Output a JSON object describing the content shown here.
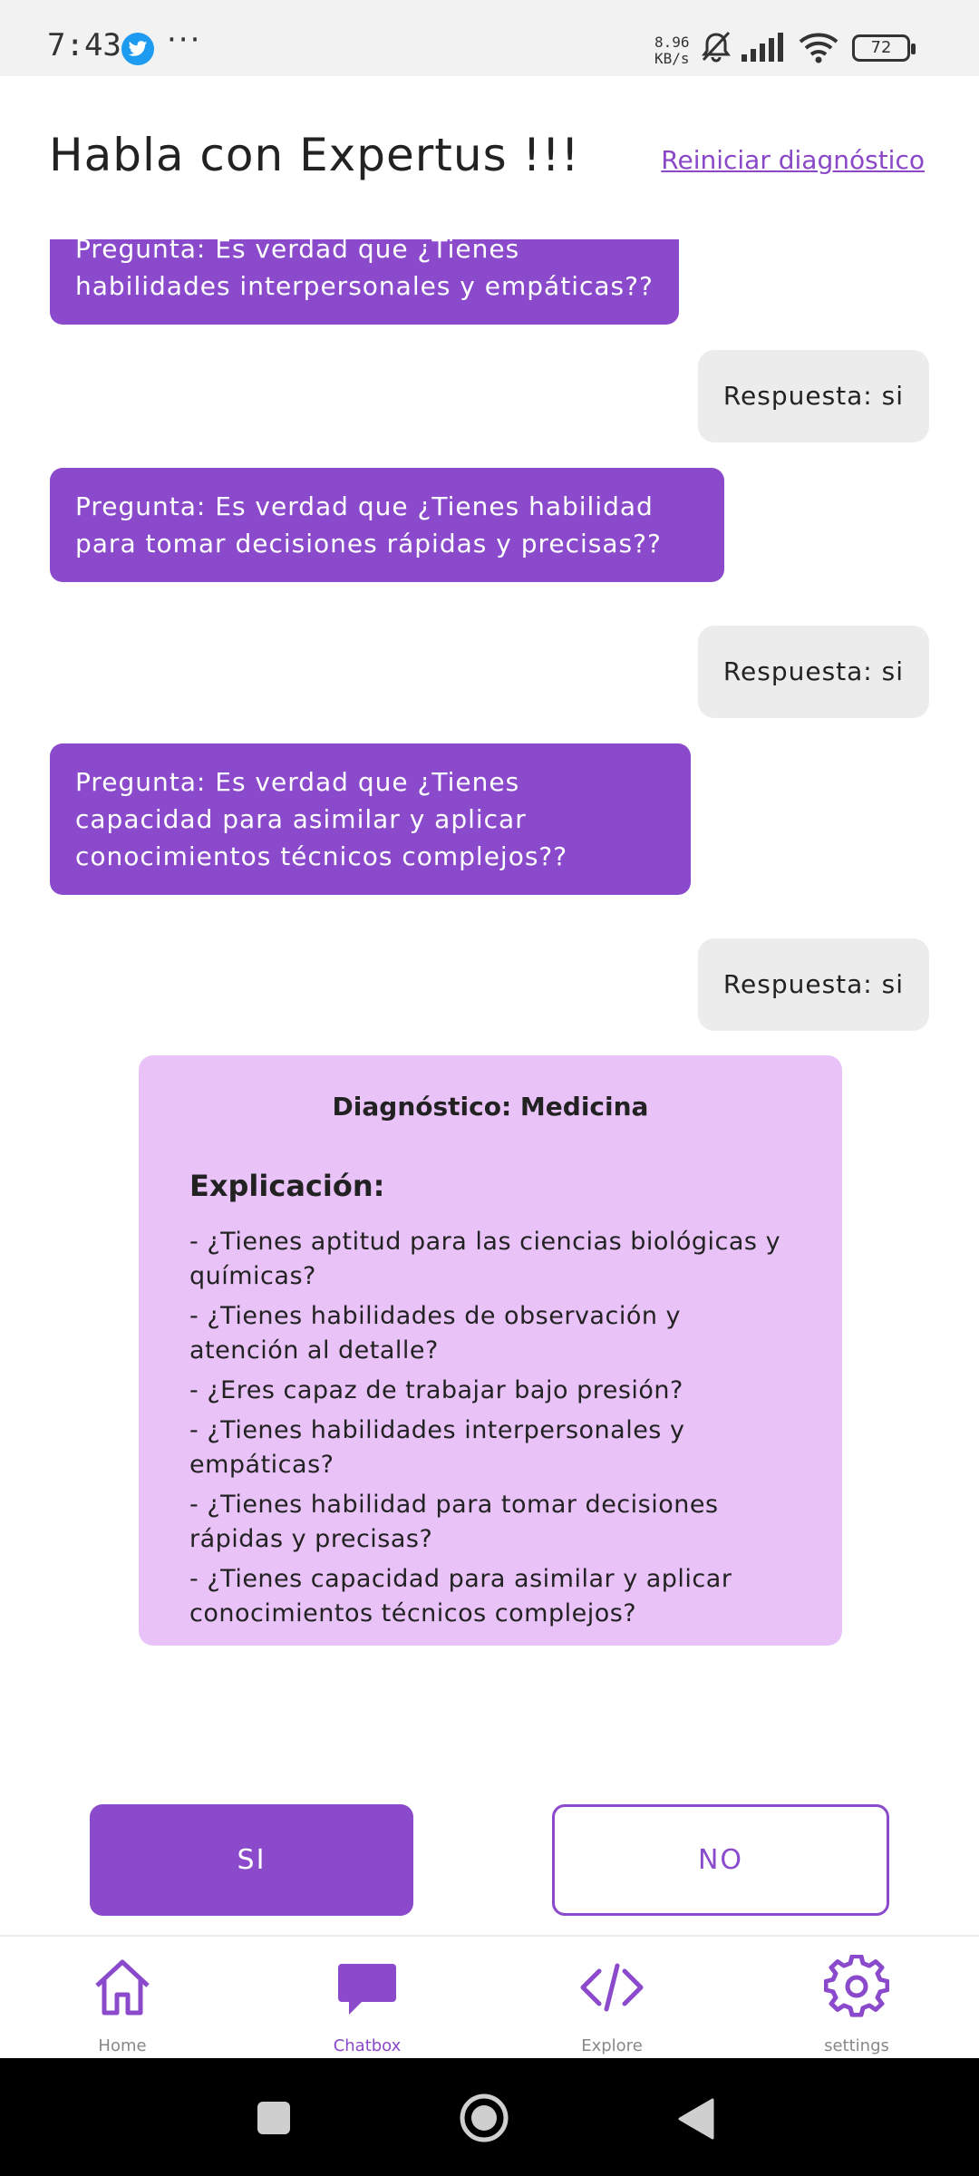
{
  "status_bar": {
    "time": "7:43",
    "net_speed_value": "8.96",
    "net_speed_unit": "KB/s",
    "battery": "72",
    "more": "···"
  },
  "header": {
    "title": "Habla con Expertus !!!",
    "reset_label": "Reiniciar diagnóstico"
  },
  "chat": {
    "messages": [
      {
        "role": "bot",
        "text": "Pregunta: Es verdad que ¿Tienes habilidades interpersonales y empáticas??"
      },
      {
        "role": "user",
        "text": "Respuesta: si"
      },
      {
        "role": "bot",
        "text": "Pregunta: Es verdad que ¿Tienes habilidad para tomar decisiones rápidas y precisas??"
      },
      {
        "role": "user",
        "text": "Respuesta: si"
      },
      {
        "role": "bot",
        "text": "Pregunta: Es verdad que ¿Tienes capacidad para asimilar y aplicar conocimientos técnicos complejos??"
      },
      {
        "role": "user",
        "text": "Respuesta: si"
      }
    ],
    "diagnosis": {
      "title": "Diagnóstico: Medicina",
      "explanation_label": "Explicación:",
      "items": [
        "- ¿Tienes aptitud para las ciencias biológicas y químicas?",
        "- ¿Tienes habilidades de observación y atención al detalle?",
        "- ¿Eres capaz de trabajar bajo presión?",
        "- ¿Tienes habilidades interpersonales y empáticas?",
        "- ¿Tienes habilidad para tomar decisiones rápidas y precisas?",
        "- ¿Tienes capacidad para asimilar y aplicar conocimientos técnicos complejos?"
      ]
    }
  },
  "actions": {
    "yes_label": "SI",
    "no_label": "NO"
  },
  "bottom_nav": {
    "items": [
      {
        "label": "Home",
        "icon": "home-icon",
        "active": false
      },
      {
        "label": "Chatbox",
        "icon": "chat-bubble-icon",
        "active": true
      },
      {
        "label": "Explore",
        "icon": "code-icon",
        "active": false
      },
      {
        "label": "settings",
        "icon": "gear-icon",
        "active": false
      }
    ]
  },
  "colors": {
    "accent": "#8a4acb",
    "diagnosis_bg": "#e9c3f8",
    "answer_bg": "#ececec"
  }
}
